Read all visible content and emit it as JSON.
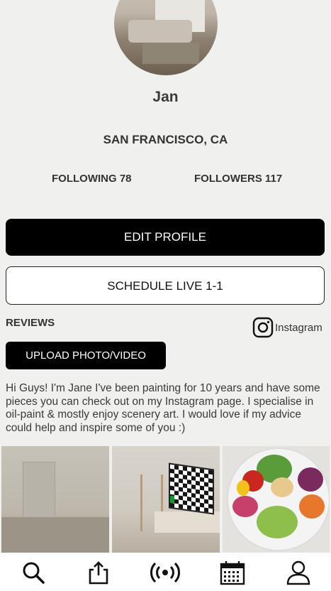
{
  "profile": {
    "name": "Jan",
    "location": "SAN FRANCISCO, CA",
    "following": "FOLLOWING 78",
    "followers": "FOLLOWERS 117"
  },
  "actions": {
    "edit_profile": "EDIT PROFILE",
    "schedule_live": "SCHEDULE LIVE 1-1",
    "upload": "UPLOAD PHOTO/VIDEO"
  },
  "reviews_label": "REVIEWS",
  "instagram_label": "Instagram",
  "bio": "Hi Guys! I'm Jane I've been painting for 10 years and have some pieces you can check out on my Instagram page. I specialise in oil-paint & mostly enjoy scenery art. I would love if my advice could help and inspire some of you :)",
  "gallery": [
    "interior-hallway-photo",
    "living-room-tv-photo",
    "salad-bowl-photo"
  ],
  "bottom_nav": [
    "search-icon",
    "share-icon",
    "live-broadcast-icon",
    "calendar-icon",
    "profile-icon"
  ]
}
